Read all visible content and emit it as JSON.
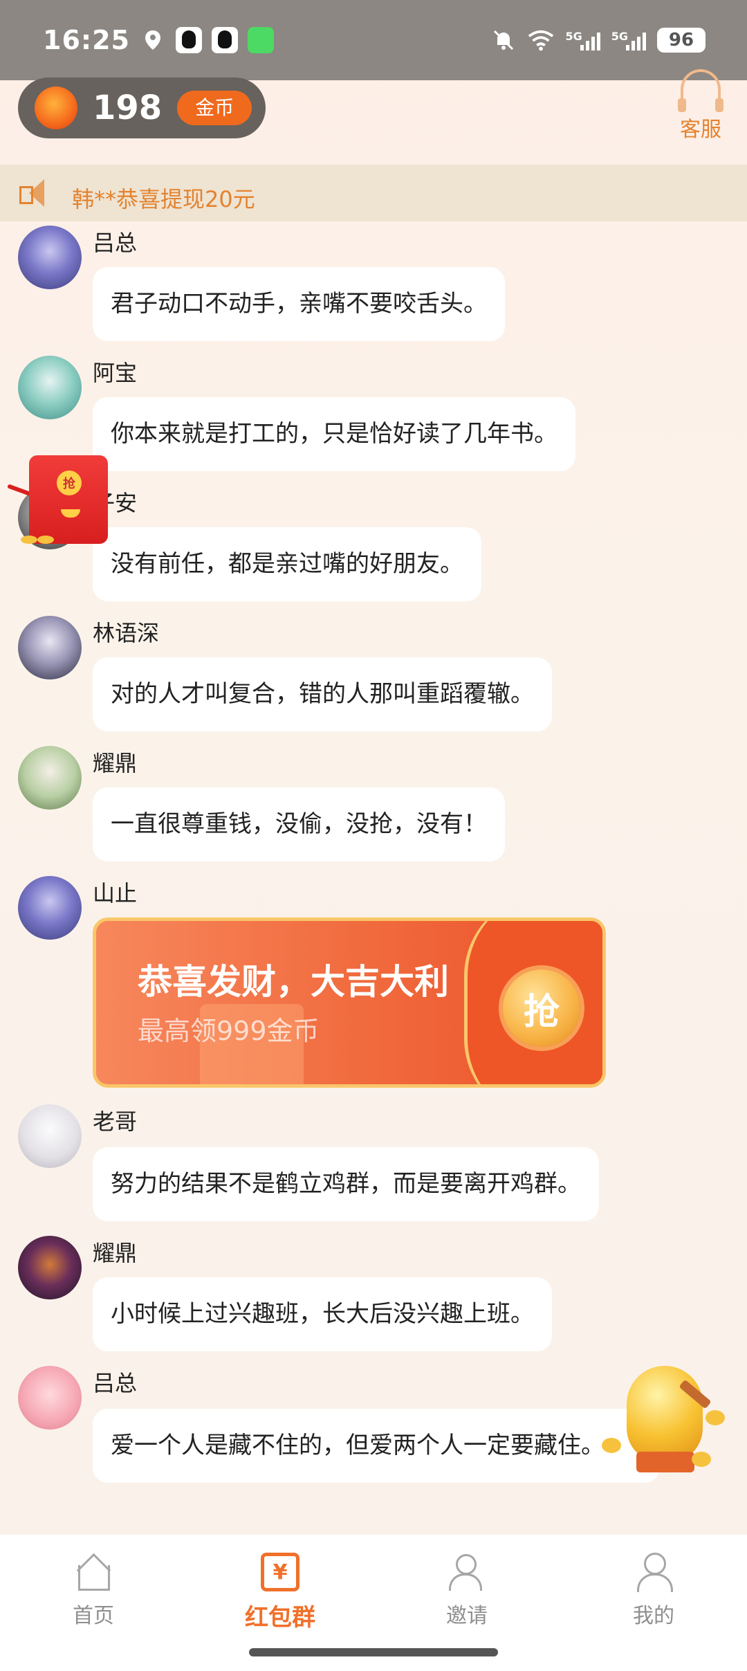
{
  "status_bar": {
    "time": "16:25",
    "battery": "96",
    "network_labels": [
      "5G",
      "5G"
    ]
  },
  "header": {
    "coins": "198",
    "coin_badge": "金币",
    "service_label": "客服"
  },
  "notice": {
    "text": "韩**恭喜提现20元"
  },
  "messages": [
    {
      "name": "吕总",
      "text": "君子动口不动手，亲嘴不要咬舌头。"
    },
    {
      "name": "阿宝",
      "text": "你本来就是打工的，只是恰好读了几年书。"
    },
    {
      "name": "子安",
      "text": "没有前任，都是亲过嘴的好朋友。"
    },
    {
      "name": "林语深",
      "text": "对的人才叫复合，错的人那叫重蹈覆辙。"
    },
    {
      "name": "耀鼎",
      "text": "一直很尊重钱，没偷，没抢，没有！"
    },
    {
      "name": "山止",
      "text": ""
    },
    {
      "name": "老哥",
      "text": "努力的结果不是鹤立鸡群，而是要离开鸡群。"
    },
    {
      "name": "耀鼎",
      "text": " 小时候上过兴趣班，长大后没兴趣上班。"
    },
    {
      "name": "吕总",
      "text": "爱一个人是藏不住的，但爱两个人一定要藏住。"
    }
  ],
  "red_packet": {
    "title": "恭喜发财，大吉大利",
    "subtitle": "最高领999金币",
    "grab_label": "抢"
  },
  "float_envelope": {
    "seal_label": "抢"
  },
  "bottom_nav": {
    "tabs": [
      {
        "label": "首页",
        "active": false
      },
      {
        "label": "红包群",
        "active": true
      },
      {
        "label": "邀请",
        "active": false
      },
      {
        "label": "我的",
        "active": false
      }
    ],
    "packet_icon_glyph": "¥"
  },
  "colors": {
    "accent": "#f0702a",
    "status_bar": "#8c8782",
    "bubble": "#ffffff",
    "packet_border": "#f9c66a"
  }
}
